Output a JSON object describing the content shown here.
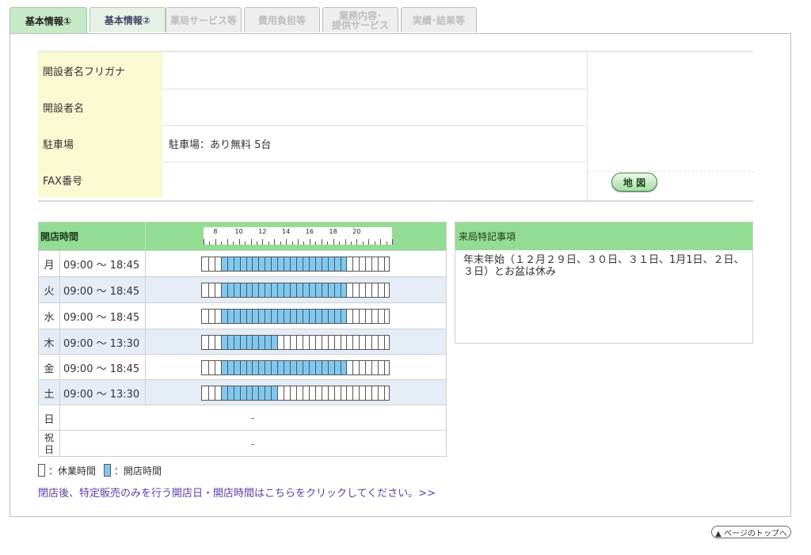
{
  "tabs": [
    {
      "label": "基本情報①",
      "state": "active"
    },
    {
      "label": "基本情報②",
      "state": "enabled"
    },
    {
      "label": "薬局サービス等",
      "state": "disabled"
    },
    {
      "label": "費用負担等",
      "state": "disabled"
    },
    {
      "label": "業務内容･\n提供サービス",
      "state": "disabled"
    },
    {
      "label": "実績･結果等",
      "state": "disabled"
    }
  ],
  "info": {
    "rows": [
      {
        "label": "開設者名フリガナ",
        "value": ""
      },
      {
        "label": "開設者名",
        "value": ""
      },
      {
        "label": "駐車場",
        "value": "駐車場：あり無料 5台"
      },
      {
        "label": "FAX番号",
        "value": ""
      }
    ],
    "map_button": "地 図"
  },
  "hours": {
    "header": "開店時間",
    "ruler_labels": [
      "8",
      "10",
      "12",
      "14",
      "16",
      "18",
      "20"
    ],
    "days": [
      {
        "day": "月",
        "time": "09:00 ～ 18:45",
        "open_from": 9.0,
        "open_to": 18.75
      },
      {
        "day": "火",
        "time": "09:00 ～ 18:45",
        "open_from": 9.0,
        "open_to": 18.75
      },
      {
        "day": "水",
        "time": "09:00 ～ 18:45",
        "open_from": 9.0,
        "open_to": 18.75
      },
      {
        "day": "木",
        "time": "09:00 ～ 13:30",
        "open_from": 9.0,
        "open_to": 13.5
      },
      {
        "day": "金",
        "time": "09:00 ～ 18:45",
        "open_from": 9.0,
        "open_to": 18.75
      },
      {
        "day": "土",
        "time": "09:00 ～ 13:30",
        "open_from": 9.0,
        "open_to": 13.5
      },
      {
        "day": "日",
        "time": "-"
      },
      {
        "day": "祝\n日",
        "time": "-"
      }
    ],
    "legend_closed": "：休業時間",
    "legend_open": "：開店時間",
    "link": "閉店後、特定販売のみを行う開店日・開店時間はこちらをクリックしてください。>>"
  },
  "notes": {
    "header": "来局特記事項",
    "body": "年末年始（１２月２９日、３０日、３１日、1月1日、２日、３日）とお盆は休み"
  },
  "pagetop": "▲ ページのトップへ",
  "colors": {
    "header_green": "#93dc93",
    "open_blue": "#7fc9f0",
    "label_yellow": "#fafad2"
  }
}
